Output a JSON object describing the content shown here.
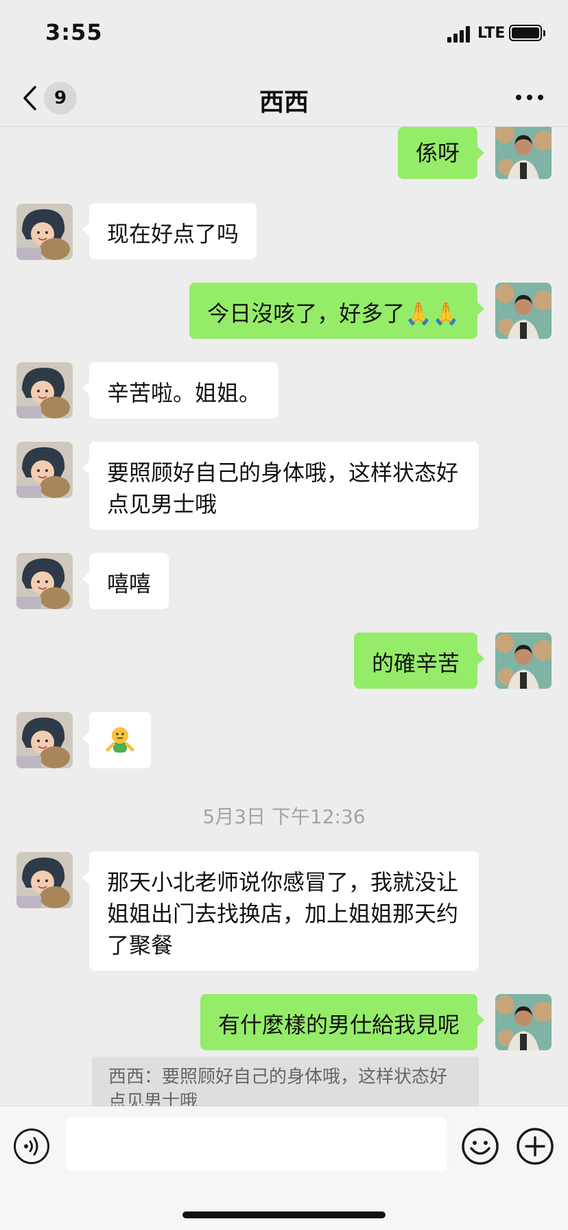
{
  "status_bar": {
    "time": "3:55",
    "network": "LTE"
  },
  "nav": {
    "back_count": "9",
    "title": "西西",
    "more_label": "more"
  },
  "messages": [
    {
      "side": "out",
      "text": "係呀"
    },
    {
      "side": "in",
      "text": "现在好点了吗"
    },
    {
      "side": "out",
      "text": "今日沒咳了，好多了🙏🙏"
    },
    {
      "side": "in",
      "text": "辛苦啦。姐姐。"
    },
    {
      "side": "in",
      "text": "要照顾好自己的身体哦，这样状态好点见男士哦"
    },
    {
      "side": "in",
      "text": "嘻嘻"
    },
    {
      "side": "out",
      "text": "的確辛苦"
    },
    {
      "side": "in",
      "text": "🙂",
      "sticker": "smiley-sticker"
    },
    {
      "side": "in",
      "text": "那天小北老师说你感冒了，我就没让姐姐出门去找换店，加上姐姐那天约了聚餐"
    },
    {
      "side": "out",
      "text": "有什麼樣的男仕給我見呢"
    }
  ],
  "timestamp": "5月3日 下午12:36",
  "quote": {
    "text": "西西：要照顾好自己的身体哦，这样状态好点见男士哦"
  },
  "input": {
    "placeholder": ""
  },
  "colors": {
    "outgoing_bubble": "#95ec69",
    "incoming_bubble": "#ffffff",
    "background": "#ededed"
  }
}
